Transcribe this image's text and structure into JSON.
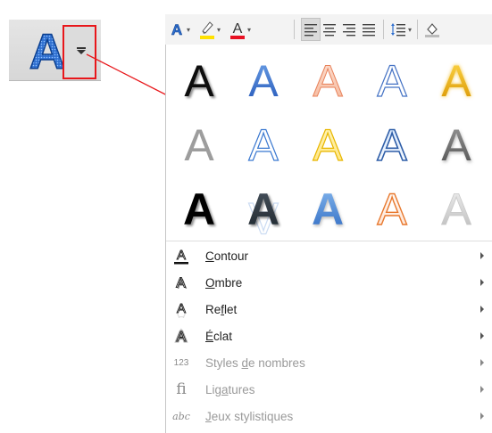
{
  "ribbon_button": {
    "icon": "text-effects-icon",
    "dropdown_icon": "chevron-down-icon",
    "highlight_color": "#e8171b"
  },
  "toolbar": {
    "items": [
      {
        "name": "text-effects-icon",
        "color": "#2f6fcf"
      },
      {
        "name": "highlighter-icon",
        "color": "#ffe100"
      },
      {
        "name": "font-color-icon",
        "color": "#e81123"
      },
      {
        "name": "align-left-icon"
      },
      {
        "name": "align-center-icon"
      },
      {
        "name": "align-right-icon"
      },
      {
        "name": "justify-icon"
      },
      {
        "name": "line-spacing-icon"
      },
      {
        "name": "shading-icon"
      }
    ]
  },
  "gallery": {
    "letter": "A",
    "styles": [
      {
        "name": "black-shadow"
      },
      {
        "name": "blue-fill"
      },
      {
        "name": "orange-outline-soft"
      },
      {
        "name": "blue-outline"
      },
      {
        "name": "gold-glow"
      },
      {
        "name": "gray-fill"
      },
      {
        "name": "blue-reflection"
      },
      {
        "name": "yellow-outline"
      },
      {
        "name": "blue-double-outline"
      },
      {
        "name": "gray-shadow"
      },
      {
        "name": "black-bold-shadow"
      },
      {
        "name": "dark-bevel"
      },
      {
        "name": "blue-bevel"
      },
      {
        "name": "orange-gradient-outline"
      },
      {
        "name": "silver-fade"
      }
    ]
  },
  "menu": {
    "items": [
      {
        "pre": "",
        "u": "C",
        "post": "ontour",
        "icon": "outline-a-icon",
        "disabled": false
      },
      {
        "pre": "",
        "u": "O",
        "post": "mbre",
        "icon": "shadow-a-icon",
        "disabled": false
      },
      {
        "pre": "Re",
        "u": "f",
        "post": "let",
        "icon": "reflection-a-icon",
        "disabled": false
      },
      {
        "pre": "",
        "u": "É",
        "post": "clat",
        "icon": "glow-a-icon",
        "disabled": false
      },
      {
        "pre": "Styles ",
        "u": "d",
        "post": "e nombres",
        "icon": "number-styles-icon",
        "icon_text": "123",
        "disabled": true
      },
      {
        "pre": "Lig",
        "u": "a",
        "post": "tures",
        "icon": "ligatures-icon",
        "icon_text": "fi",
        "disabled": true
      },
      {
        "pre": "",
        "u": "J",
        "post": "eux stylistiques",
        "icon": "stylistic-sets-icon",
        "icon_text": "abc",
        "disabled": true
      }
    ]
  }
}
